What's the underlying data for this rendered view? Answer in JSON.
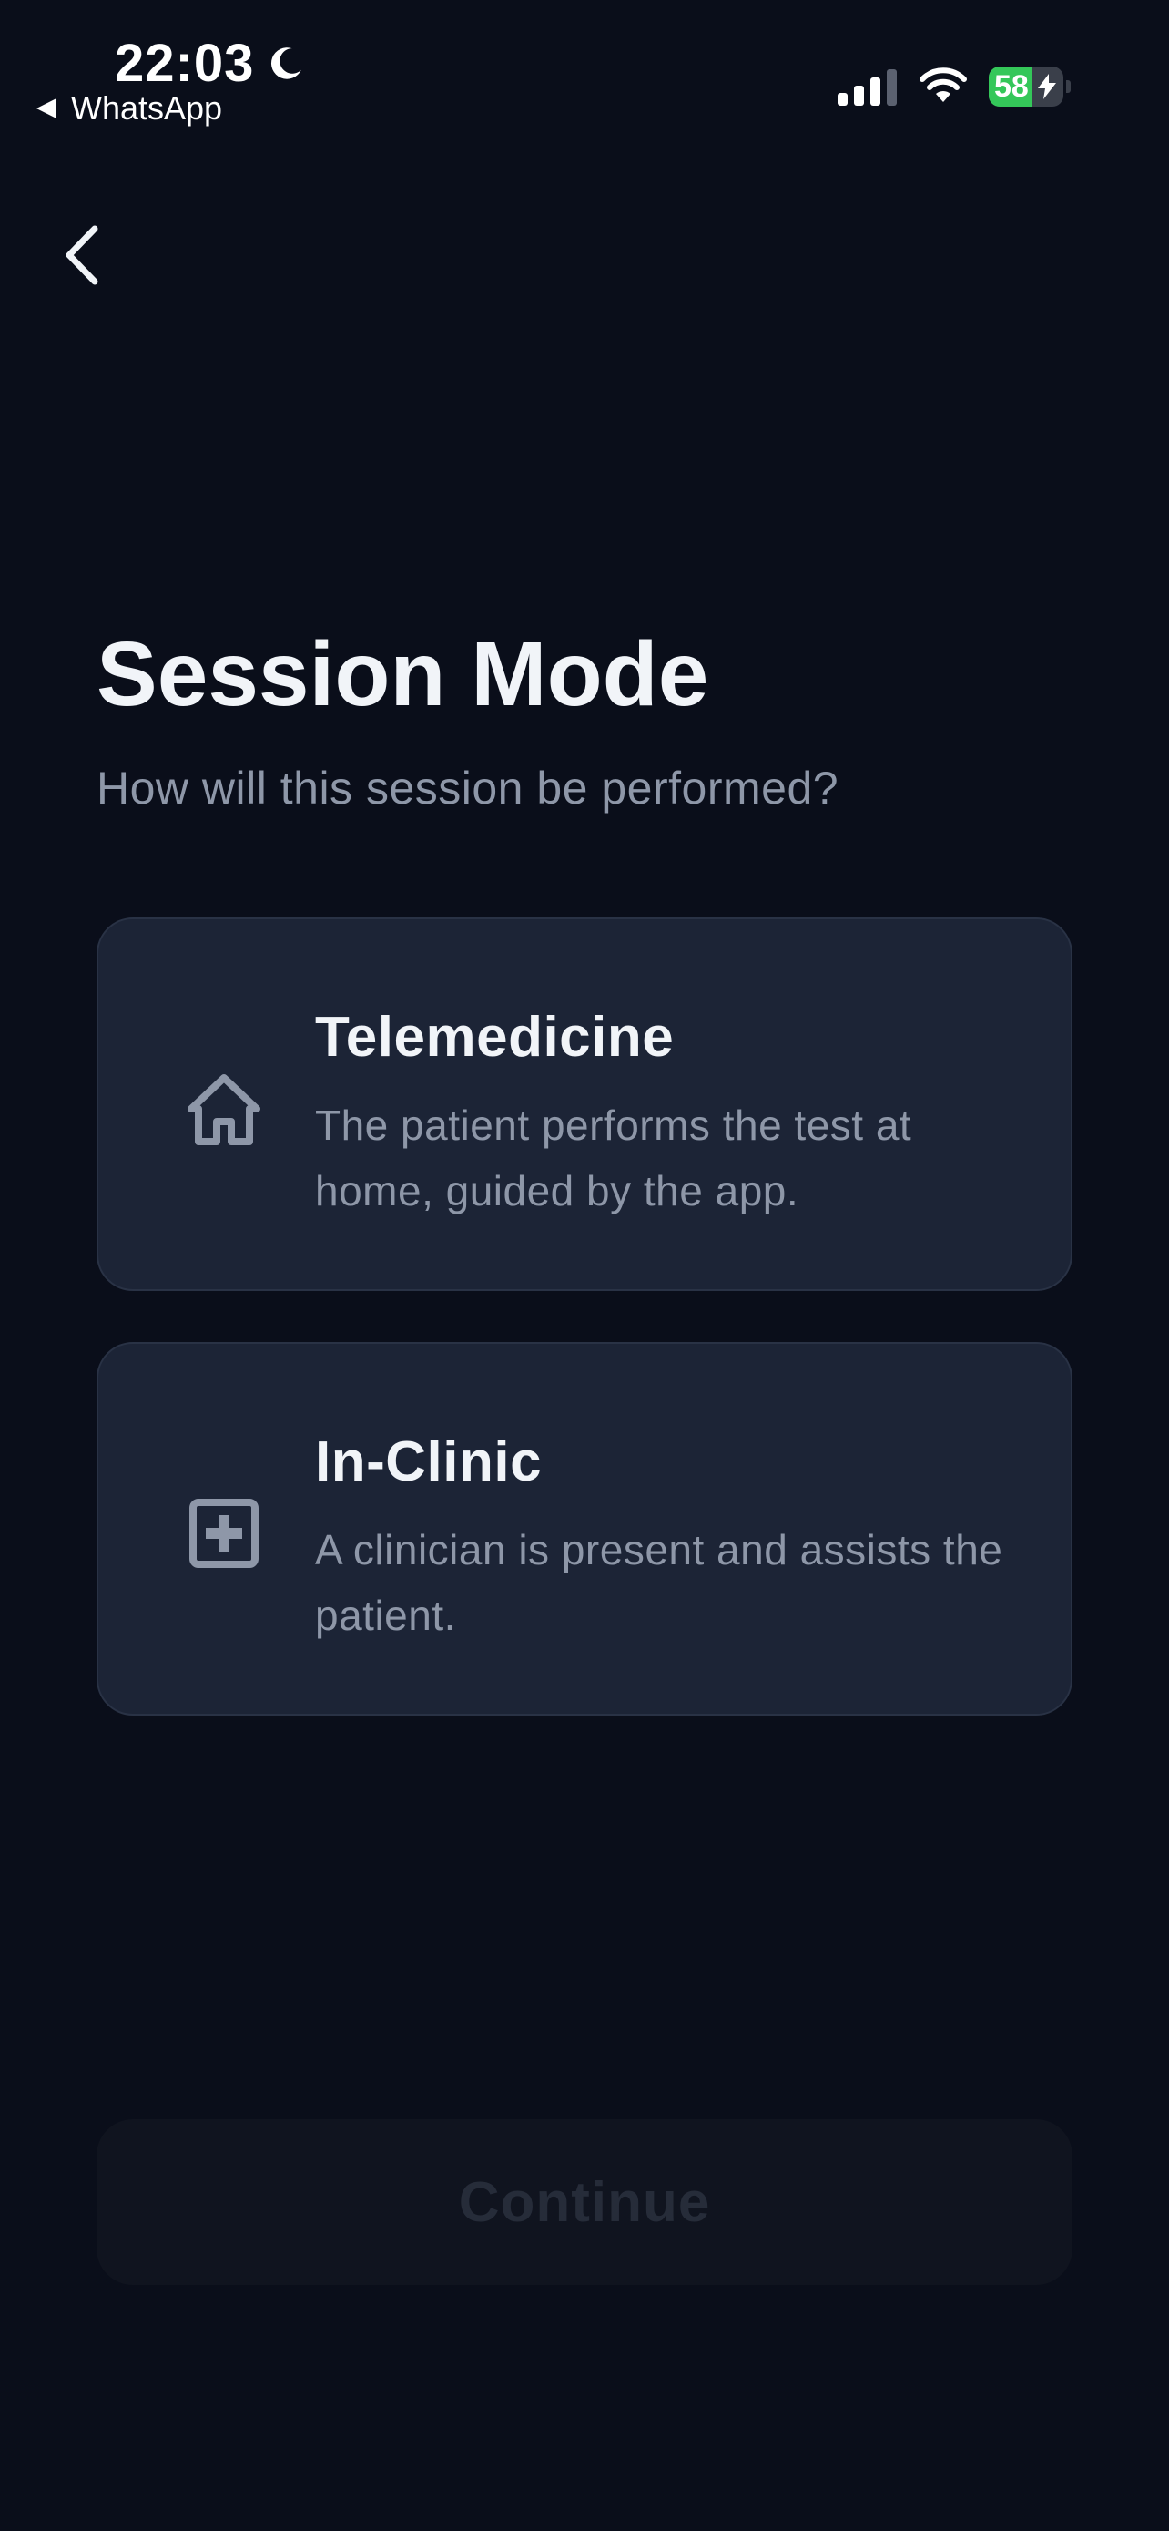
{
  "status_bar": {
    "time": "22:03",
    "back_app_label": "WhatsApp",
    "battery_percent": "58",
    "battery_level": 0.58,
    "battery_color": "#34c759",
    "signal_bars_active": 3,
    "icons": [
      "moon-icon",
      "signal-icon",
      "wifi-icon",
      "battery-icon",
      "bolt-icon"
    ]
  },
  "navigation": {
    "back_icon": "chevron-left-icon"
  },
  "header": {
    "title": "Session Mode",
    "subtitle": "How will this session be performed?"
  },
  "options": [
    {
      "title": "Telemedicine",
      "description": "The patient performs the test at home, guided by the app.",
      "icon": "home-icon"
    },
    {
      "title": "In-Clinic",
      "description": "A clinician is present and assists the patient.",
      "icon": "medical-cross-icon"
    }
  ],
  "footer": {
    "continue_label": "Continue",
    "continue_enabled": false
  },
  "colors": {
    "background": "#0a0e1a",
    "card": "#1c2436",
    "card_border": "#293245",
    "title_text": "#f1f4f8",
    "muted_text": "#8e97a8",
    "disabled_button": "#10141f",
    "disabled_text": "#262c39"
  }
}
